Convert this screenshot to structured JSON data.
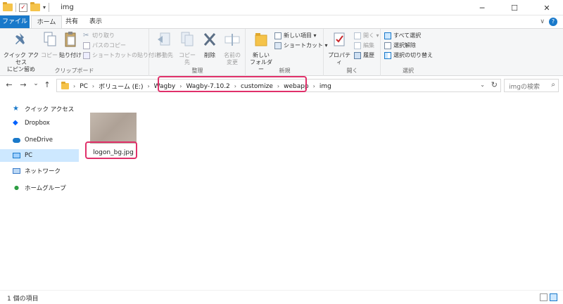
{
  "window": {
    "title": "img",
    "minimize": "─",
    "maximize": "☐",
    "close": "✕",
    "qat_dropdown": "▾"
  },
  "tabs": {
    "file": "ファイル",
    "home": "ホーム",
    "share": "共有",
    "view": "表示",
    "collapse": "∨",
    "help": "?"
  },
  "ribbon": {
    "clipboard": {
      "label": "クリップボード",
      "pin_quick": "クイック アクセス\nにピン留め",
      "copy": "コピー",
      "paste": "貼り付け",
      "cut": "切り取り",
      "copy_path": "パスのコピー",
      "paste_shortcut": "ショートカットの貼り付け"
    },
    "organize": {
      "label": "整理",
      "move_to": "移動先",
      "copy_to": "コピー先",
      "delete": "削除",
      "rename": "名前の\n変更"
    },
    "new": {
      "label": "新規",
      "new_folder": "新しい\nフォルダー",
      "new_item": "新しい項目 ▾",
      "shortcut": "ショートカット ▾"
    },
    "open": {
      "label": "開く",
      "properties": "プロパティ",
      "open": "開く ▾",
      "edit": "編集",
      "history": "履歴"
    },
    "select": {
      "label": "選択",
      "select_all": "すべて選択",
      "select_none": "選択解除",
      "invert": "選択の切り替え"
    }
  },
  "nav": {
    "back": "←",
    "forward": "→",
    "recent": "⌄",
    "up": "↑",
    "breadcrumb": [
      "PC",
      "ボリューム (E:)",
      "Wagby",
      "Wagby-7.10.2",
      "customize",
      "webapp",
      "img"
    ],
    "crumb_sep": "›",
    "dropdown": "⌄",
    "refresh": "↻",
    "search_placeholder": "imgの検索",
    "search_icon": "⌕"
  },
  "sidebar": {
    "items": [
      {
        "label": "クイック アクセス",
        "icon": "star-icon"
      },
      {
        "label": "Dropbox",
        "icon": "dropbox-icon"
      },
      {
        "label": "OneDrive",
        "icon": "cloud-icon"
      },
      {
        "label": "PC",
        "icon": "computer-icon"
      },
      {
        "label": "ネットワーク",
        "icon": "network-icon"
      },
      {
        "label": "ホームグループ",
        "icon": "homegroup-icon"
      }
    ]
  },
  "content": {
    "files": [
      {
        "name": "logon_bg.jpg",
        "type": "image"
      }
    ]
  },
  "status": {
    "count": "1 個の項目"
  },
  "colors": {
    "accent": "#1979ca",
    "highlight": "#e0306a",
    "selected": "#cde8ff"
  }
}
